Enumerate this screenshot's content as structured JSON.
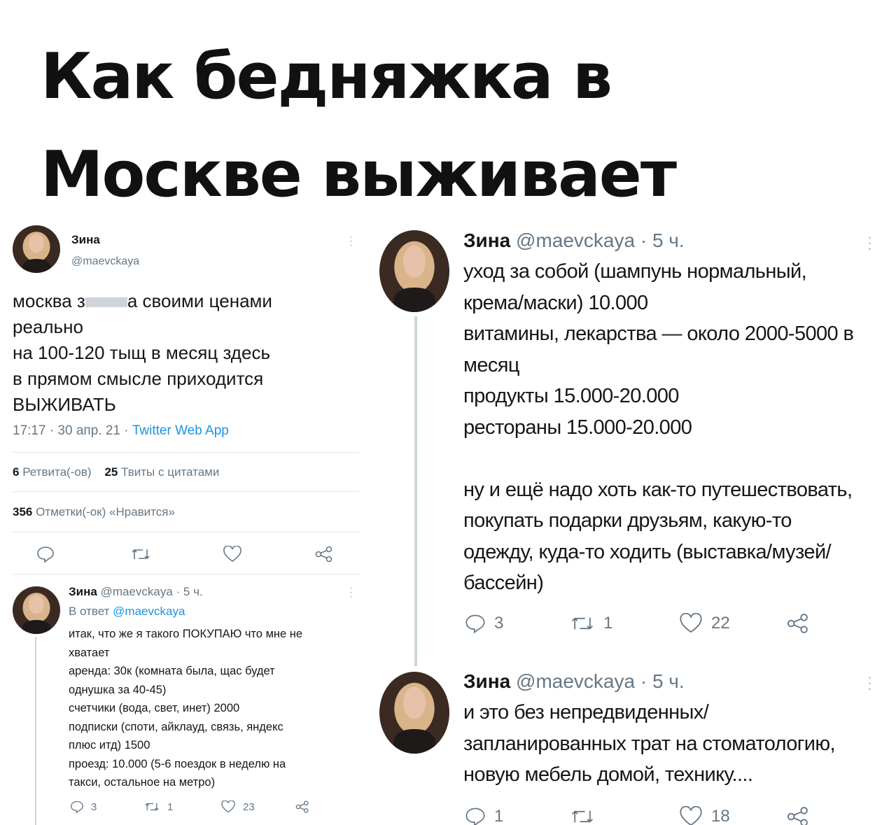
{
  "headline": "Как бедняжка в Москве выживает",
  "left_tweet": {
    "name": "Зина",
    "handle": "@maevckaya",
    "body_prefix": "москва з",
    "body_suffix": "а своими ценами",
    "body_lines": [
      "реально",
      "на 100-120 тыщ в месяц здесь",
      "в прямом смысле приходится",
      "ВЫЖИВАТЬ"
    ],
    "time": "17:17 · 30 апр. 21 · ",
    "source": "Twitter Web App",
    "retweets_count": "6",
    "retweets_label": "Ретвита(-ов)",
    "quotes_count": "25",
    "quotes_label": "Твиты с цитатами",
    "likes_count": "356",
    "likes_label": "Отметки(-ок) «Нравится»"
  },
  "left_reply": {
    "name": "Зина",
    "handle_time": "@maevckaya · 5 ч.",
    "reply_prefix": "В ответ ",
    "reply_handle": "@maevckaya",
    "body_lines": [
      "итак, что же я такого ПОКУПАЮ что мне не",
      "хватает",
      "аренда: 30к (комната была, щас будет",
      "однушка за 40-45)",
      "счетчики (вода, свет, инет) 2000",
      "подписки (споти, айклауд, связь, яндекс",
      "плюс итд) 1500",
      "проезд: 10.000 (5-6 поездок в неделю на",
      "такси, остальное на метро)"
    ],
    "replies": "3",
    "retweets": "1",
    "likes": "23"
  },
  "right_tweet_1": {
    "name": "Зина",
    "handle_time": "@maevckaya · 5 ч.",
    "body_lines": [
      "уход за собой (шампунь нормальный,",
      "крема/маски) 10.000",
      "витамины, лекарства — около 2000-5000 в",
      "месяц",
      "продукты 15.000-20.000",
      "рестораны 15.000-20.000",
      "",
      "ну и ещё надо хоть как-то путешествовать,",
      "покупать подарки друзьям, какую-то",
      "одежду, куда-то ходить (выставка/музей/",
      "бассейн)"
    ],
    "replies": "3",
    "retweets": "1",
    "likes": "22"
  },
  "right_tweet_2": {
    "name": "Зина",
    "handle_time": "@maevckaya · 5 ч.",
    "body_lines": [
      "и это без непредвиденных/",
      "запланированных трат на стоматологию,",
      "новую мебель домой, технику...."
    ],
    "replies": "1",
    "likes": "18"
  },
  "colors": {
    "link": "#1b95e0",
    "muted": "#657786",
    "thread_line": "#ccd6dd"
  }
}
